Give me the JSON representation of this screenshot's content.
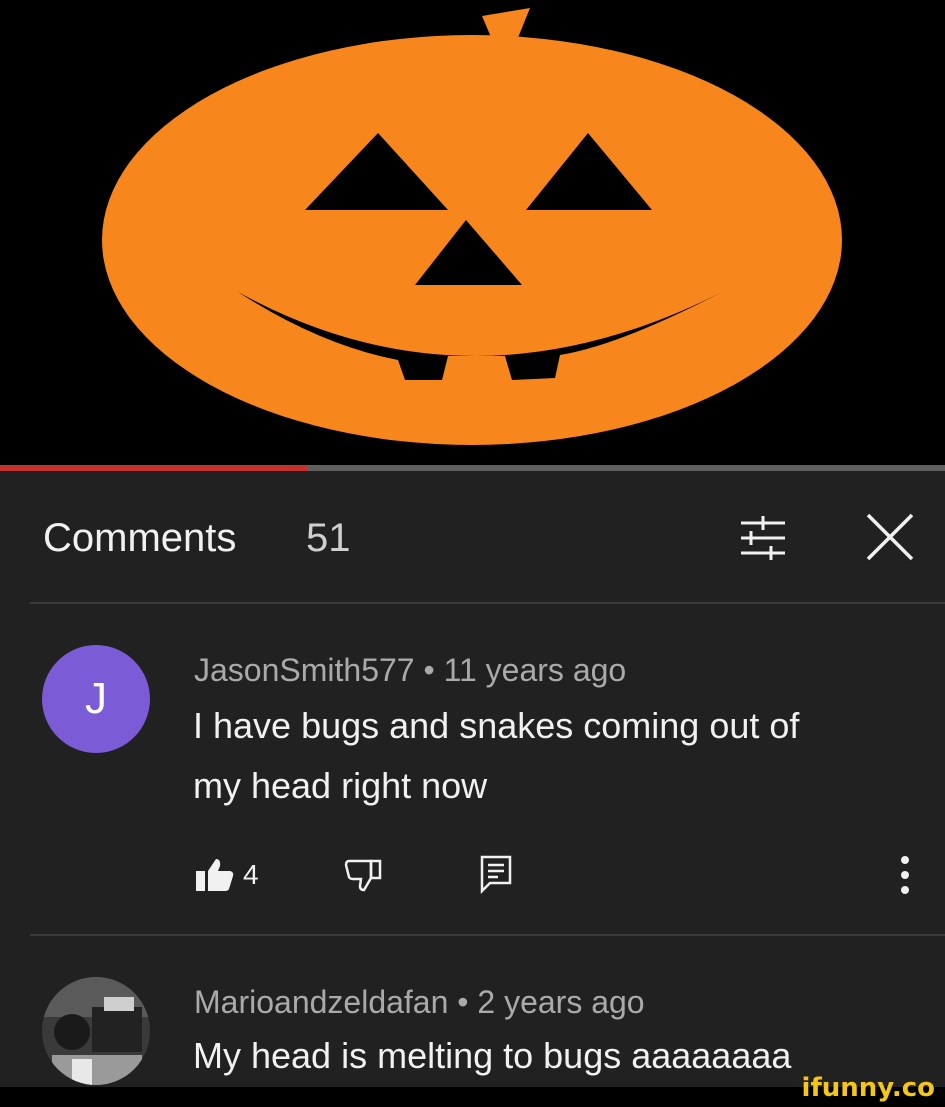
{
  "video": {
    "progress_fraction": 0.325,
    "pumpkin_color": "#f7861d"
  },
  "comments_header": {
    "title": "Comments",
    "count": "51",
    "sort_icon": "sort-filter-icon",
    "close_icon": "close-icon"
  },
  "comments": [
    {
      "author_meta": "JasonSmith577 • 11 years ago",
      "avatar_letter": "J",
      "avatar_color": "#7b5bd6",
      "text_lines": [
        "I have bugs and snakes coming out of",
        "my head right now"
      ],
      "likes": "4"
    },
    {
      "author_meta": "Marioandzeldafan • 2 years ago",
      "text_lines": [
        "My head is melting to bugs aaaaaaaa"
      ]
    }
  ],
  "watermark": "ifunny.co"
}
